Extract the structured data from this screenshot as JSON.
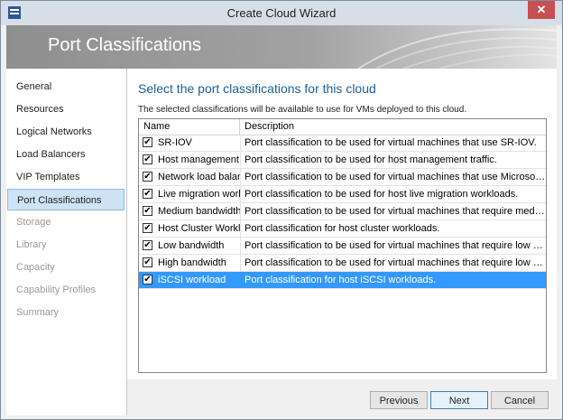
{
  "window": {
    "title": "Create Cloud Wizard",
    "close_glyph": "✕"
  },
  "banner": {
    "title": "Port Classifications"
  },
  "nav": {
    "items": [
      {
        "label": "General",
        "state": "enabled"
      },
      {
        "label": "Resources",
        "state": "enabled"
      },
      {
        "label": "Logical Networks",
        "state": "enabled"
      },
      {
        "label": "Load Balancers",
        "state": "enabled"
      },
      {
        "label": "VIP Templates",
        "state": "enabled"
      },
      {
        "label": "Port Classifications",
        "state": "selected"
      },
      {
        "label": "Storage",
        "state": "disabled"
      },
      {
        "label": "Library",
        "state": "disabled"
      },
      {
        "label": "Capacity",
        "state": "disabled"
      },
      {
        "label": "Capability Profiles",
        "state": "disabled"
      },
      {
        "label": "Summary",
        "state": "disabled"
      }
    ]
  },
  "main": {
    "heading": "Select the port classifications for this cloud",
    "instruction": "The selected classifications will be available to use for VMs deployed to this cloud.",
    "columns": {
      "name": "Name",
      "description": "Description"
    },
    "rows": [
      {
        "name": "SR-IOV",
        "description": "Port classification to be used for virtual machines that use SR-IOV.",
        "checked": true,
        "selected": false
      },
      {
        "name": "Host management",
        "description": "Port classification to be used for host management traffic.",
        "checked": true,
        "selected": false
      },
      {
        "name": "Network load balancing",
        "description": "Port classification to be used for virtual machines that use Microsoft Network Load Balancing.",
        "checked": true,
        "selected": false
      },
      {
        "name": "Live migration workload",
        "description": "Port classification to be used for host live migration workloads.",
        "checked": true,
        "selected": false
      },
      {
        "name": "Medium bandwidth",
        "description": "Port classification to be used for virtual machines that require medium bandwidth.",
        "checked": true,
        "selected": false
      },
      {
        "name": "Host Cluster Workload",
        "description": "Port classification for host cluster workloads.",
        "checked": true,
        "selected": false
      },
      {
        "name": "Low bandwidth",
        "description": "Port classification to be used for virtual machines that require low bandwidth.",
        "checked": true,
        "selected": false
      },
      {
        "name": "High bandwidth",
        "description": "Port classification to be used for virtual machines that require low bandwidth.",
        "checked": true,
        "selected": false
      },
      {
        "name": "iSCSI workload",
        "description": "Port classification for host iSCSI workloads.",
        "checked": true,
        "selected": true
      }
    ],
    "check_glyph": "✔"
  },
  "footer": {
    "previous_label": "Previous",
    "next_label": "Next",
    "cancel_label": "Cancel"
  },
  "colors": {
    "heading": "#1a5f9e",
    "selection": "#3399ff",
    "nav_selected": "#cfe3f6",
    "close_button": "#c75050"
  }
}
